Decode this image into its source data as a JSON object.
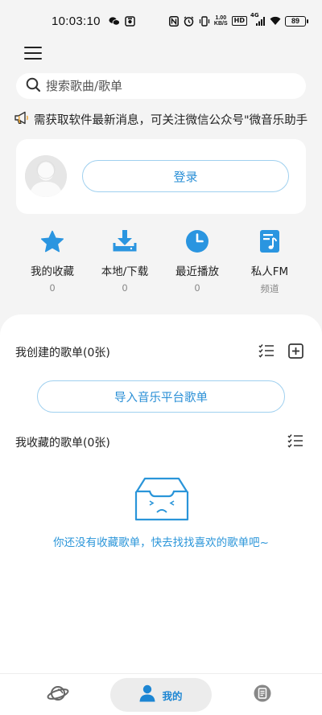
{
  "status_bar": {
    "time": "10:03:10",
    "net_speed_value": "1.00",
    "net_speed_unit": "KB/S",
    "hd": "HD",
    "signal": "4G",
    "battery": "89"
  },
  "search": {
    "placeholder": "搜索歌曲/歌单"
  },
  "notice": {
    "text": "需获取软件最新消息，可关注微信公众号\"微音乐助手"
  },
  "login": {
    "button_label": "登录"
  },
  "quick_links": [
    {
      "label": "我的收藏",
      "count": "0",
      "icon": "star-icon"
    },
    {
      "label": "本地/下载",
      "count": "0",
      "icon": "download-icon"
    },
    {
      "label": "最近播放",
      "count": "0",
      "icon": "clock-icon"
    },
    {
      "label": "私人FM",
      "count": "频道",
      "icon": "music-note-icon"
    }
  ],
  "created_playlists": {
    "title": "我创建的歌单(0张)",
    "import_label": "导入音乐平台歌单"
  },
  "collected_playlists": {
    "title": "我收藏的歌单(0张)",
    "empty_message": "你还没有收藏歌单，快去找找喜欢的歌单吧~"
  },
  "bottom_nav": {
    "items": [
      {
        "label": "",
        "icon": "planet-icon",
        "active": false
      },
      {
        "label": "我的",
        "icon": "user-icon",
        "active": true
      },
      {
        "label": "",
        "icon": "document-icon",
        "active": false
      }
    ]
  },
  "colors": {
    "accent": "#1d86d3",
    "accent_light": "#9fd0ef",
    "background": "#f4f4f4",
    "card": "#ffffff"
  }
}
